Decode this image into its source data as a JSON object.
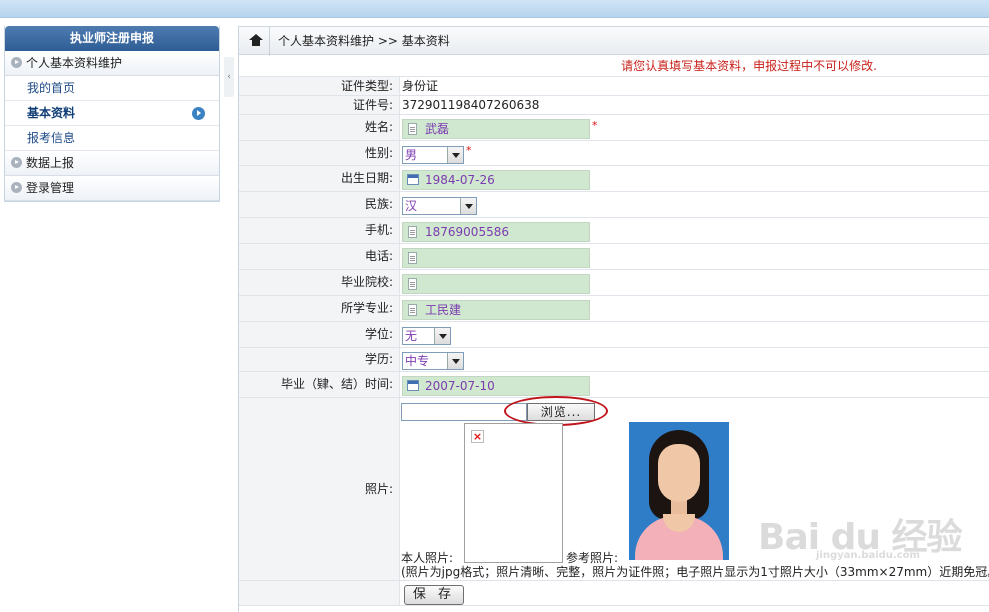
{
  "sidebar": {
    "title": "执业师注册申报",
    "sections": [
      {
        "label": "个人基本资料维护"
      },
      {
        "label": "数据上报"
      },
      {
        "label": "登录管理"
      }
    ],
    "items": [
      {
        "label": "我的首页"
      },
      {
        "label": "基本资料"
      },
      {
        "label": "报考信息"
      }
    ],
    "collapse_glyph": "‹"
  },
  "breadcrumb": "个人基本资料维护 >> 基本资料",
  "notice": "请您认真填写基本资料，申报过程中不可以修改.",
  "form": {
    "id_type": {
      "label": "证件类型:",
      "value": "身份证"
    },
    "id_number": {
      "label": "证件号:",
      "value": "372901198407260638"
    },
    "name": {
      "label": "姓名:",
      "value": "武磊"
    },
    "gender": {
      "label": "性别:",
      "value": "男"
    },
    "birth_date": {
      "label": "出生日期:",
      "value": "1984-07-26"
    },
    "ethnicity": {
      "label": "民族:",
      "value": "汉"
    },
    "mobile": {
      "label": "手机:",
      "value": "18769005586"
    },
    "phone": {
      "label": "电话:",
      "value": ""
    },
    "school": {
      "label": "毕业院校:",
      "value": ""
    },
    "major": {
      "label": "所学专业:",
      "value": "工民建"
    },
    "degree": {
      "label": "学位:",
      "value": "无"
    },
    "education": {
      "label": "学历:",
      "value": "中专"
    },
    "grad_date": {
      "label": "毕业（肄、结）时间:",
      "value": "2007-07-10"
    },
    "photo": {
      "label": "照片:",
      "browse_label": "浏览...",
      "own_caption": "本人照片:",
      "ref_caption": "参考照片:",
      "note": "(照片为jpg格式；照片清晰、完整，照片为证件照；电子照片显示为1寸照片大小（33mm×27mm）近期免冠。"
    },
    "required_mark": "*",
    "save_label": "保 存"
  },
  "watermark": {
    "text": "Bai du 经验",
    "sub": "jingyan.baidu.com"
  },
  "colors": {
    "field_bg": "#cfe8cf",
    "value_text": "#7d3bb0",
    "notice": "#c8201a",
    "sidebar_header": "#2e5d95"
  }
}
